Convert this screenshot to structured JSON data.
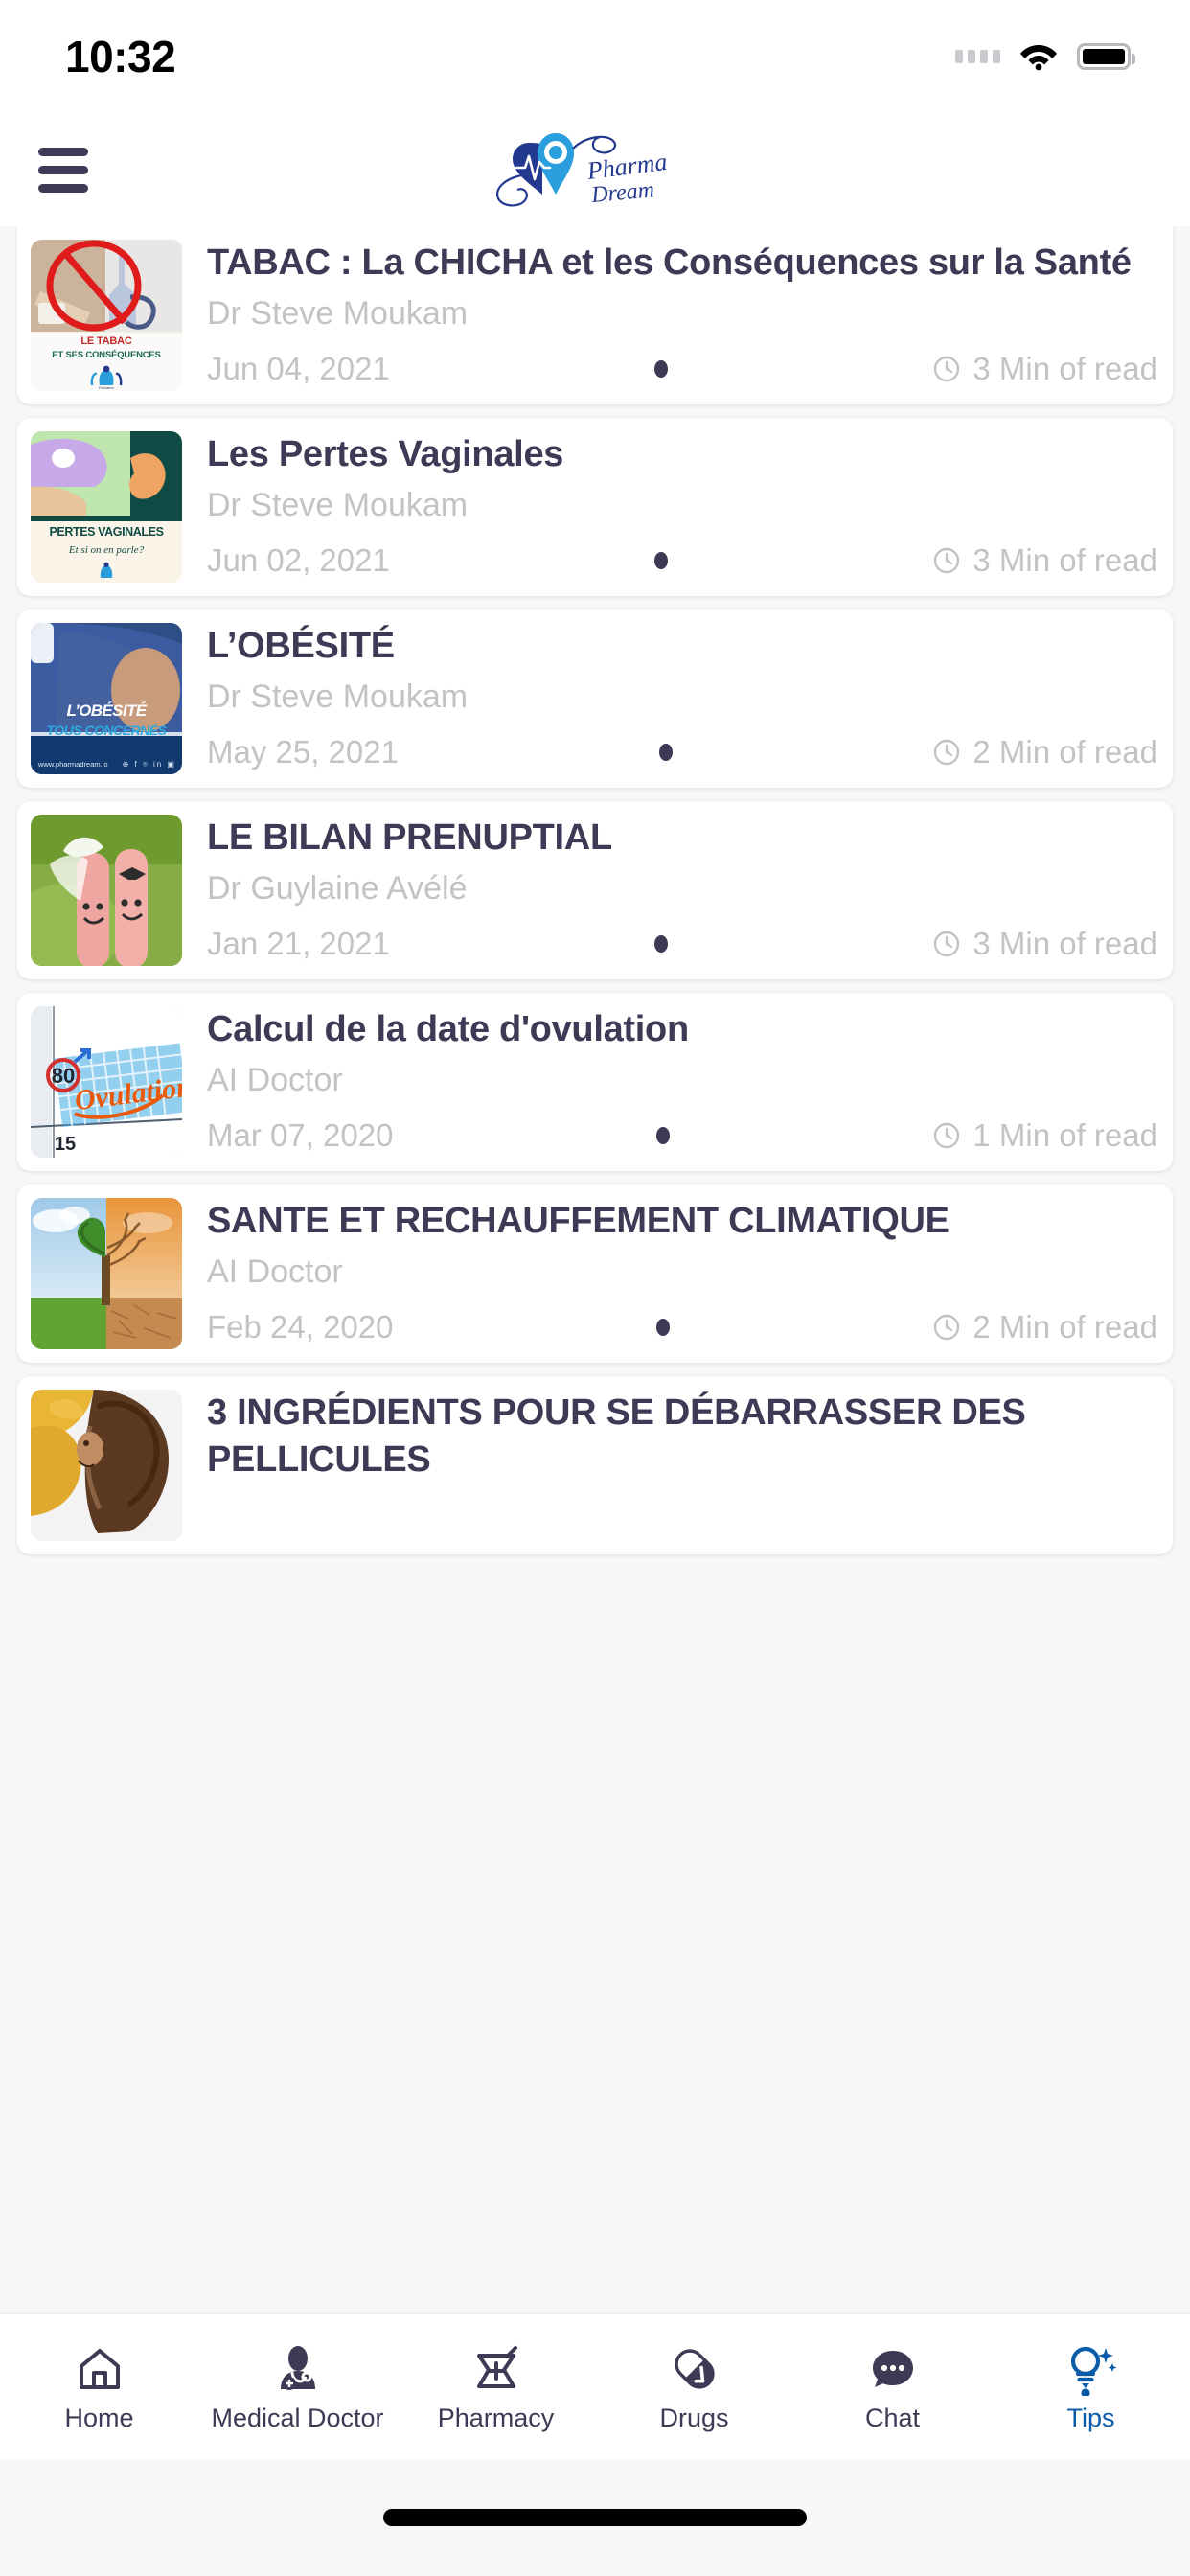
{
  "status_bar": {
    "time": "10:32",
    "signal_icon": "signal-dots-icon",
    "wifi_icon": "wifi-icon",
    "battery_icon": "battery-full-icon"
  },
  "header": {
    "menu_icon": "hamburger-menu-icon",
    "brand_name": "Pharma Dream",
    "brand_logo_icon": "pharma-dream-logo-icon"
  },
  "colors": {
    "title": "#3d3a55",
    "muted": "#c3c3c6",
    "accent": "#0b5ca8",
    "page_bg": "#f7f7f8",
    "card_bg": "#ffffff"
  },
  "feed": {
    "articles": [
      {
        "title": "TABAC : La CHICHA et les Conséquences sur la Santé",
        "author": "Dr Steve Moukam",
        "date": "Jun 04, 2021",
        "read_time": "3 Min of read",
        "thumb_caption_1": "LE TABAC",
        "thumb_caption_2": "ET SES CONSÉQUENCES",
        "thumb_name": "tabac-chicha-thumbnail"
      },
      {
        "title": "Les Pertes Vaginales",
        "author": "Dr Steve Moukam",
        "date": "Jun 02, 2021",
        "read_time": "3 Min of read",
        "thumb_caption_1": "PERTES VAGINALES",
        "thumb_caption_2": "Et si on en parle?",
        "thumb_name": "pertes-vaginales-thumbnail"
      },
      {
        "title": "L’OBÉSITÉ",
        "author": "Dr Steve Moukam",
        "date": "May 25, 2021",
        "read_time": "2 Min of read",
        "thumb_caption_1": "L’OBÉSITÉ",
        "thumb_caption_2": "TOUS CONCERNÉS",
        "thumb_name": "obesite-thumbnail"
      },
      {
        "title": "LE BILAN PRENUPTIAL",
        "author": "Dr Guylaine Avélé",
        "date": "Jan 21, 2021",
        "read_time": "3 Min of read",
        "thumb_caption_1": "",
        "thumb_caption_2": "",
        "thumb_name": "bilan-prenuptial-thumbnail"
      },
      {
        "title": "Calcul de la date d'ovulation",
        "author": "AI Doctor",
        "date": "Mar 07, 2020",
        "read_time": "1 Min of read",
        "thumb_caption_1": "Ovulation",
        "thumb_caption_2": "15",
        "thumb_name": "calcul-ovulation-thumbnail"
      },
      {
        "title": "SANTE ET RECHAUFFEMENT CLIMATIQUE",
        "author": "AI Doctor",
        "date": "Feb 24, 2020",
        "read_time": "2 Min of read",
        "thumb_caption_1": "",
        "thumb_caption_2": "",
        "thumb_name": "rechauffement-climatique-thumbnail"
      },
      {
        "title": "3 INGRÉDIENTS POUR SE DÉBARRASSER DES PELLICULES",
        "author": "",
        "date": "",
        "read_time": "",
        "thumb_caption_1": "",
        "thumb_caption_2": "",
        "thumb_name": "pellicules-thumbnail"
      }
    ]
  },
  "tabbar": {
    "items": [
      {
        "label": "Home",
        "icon": "home-icon",
        "active": false
      },
      {
        "label": "Medical Doctor",
        "icon": "doctor-stethoscope-icon",
        "active": false
      },
      {
        "label": "Pharmacy",
        "icon": "mortar-pestle-icon",
        "active": false
      },
      {
        "label": "Drugs",
        "icon": "pill-capsule-icon",
        "active": false
      },
      {
        "label": "Chat",
        "icon": "chat-bubble-icon",
        "active": false
      },
      {
        "label": "Tips",
        "icon": "lightbulb-sparkle-icon",
        "active": true
      }
    ]
  },
  "home_indicator": {
    "icon": "home-indicator-bar"
  }
}
